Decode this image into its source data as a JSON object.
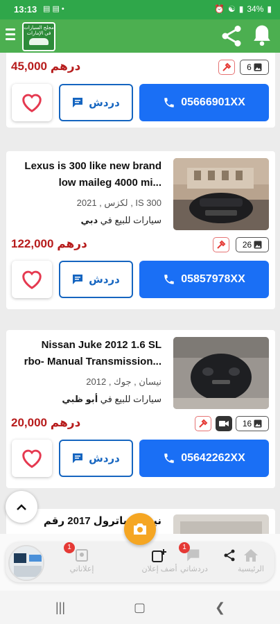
{
  "status_bar": {
    "time": "13:13",
    "battery": "34%"
  },
  "app": {
    "logo_text": "مجلح السيارات في الإمارات"
  },
  "listings": [
    {
      "price": "45,000 درهم",
      "photo_count": "6",
      "chat_label": "دردش",
      "phone": "05666901XX"
    },
    {
      "title_line1": "Lexus is 300 like new brand",
      "title_line2": "low maileg 4000 mi...",
      "model": "لكزس , 2021 , IS 300",
      "location_prefix": "سيارات للبيع في",
      "location_city": "دبي",
      "price": "122,000 درهم",
      "photo_count": "26",
      "chat_label": "دردش",
      "phone": "05857978XX"
    },
    {
      "title_line1": "Nissan Juke 2012 1.6 SL",
      "title_line2": "rbo- Manual Transmission...",
      "model": "نيسان , جوك , 2012",
      "location_prefix": "سيارات للبيع في",
      "location_city": "أبو ظبي",
      "price": "20,000 درهم",
      "photo_count": "16",
      "chat_label": "دردش",
      "phone": "05642262XX"
    },
    {
      "title_line1": "نيسان باترول 2017 رقم"
    }
  ],
  "bottom_nav": {
    "home": "الرئيسية",
    "chats": "دردشاتي",
    "add_ad": "أضف إعلان",
    "my_ads": "إعلاناتي",
    "badge_chats": "1",
    "badge_ads": "1"
  },
  "colors": {
    "green": "#4caf50",
    "blue": "#1a6ff5",
    "price_red": "#b71c1c",
    "heart": "#e53950"
  }
}
